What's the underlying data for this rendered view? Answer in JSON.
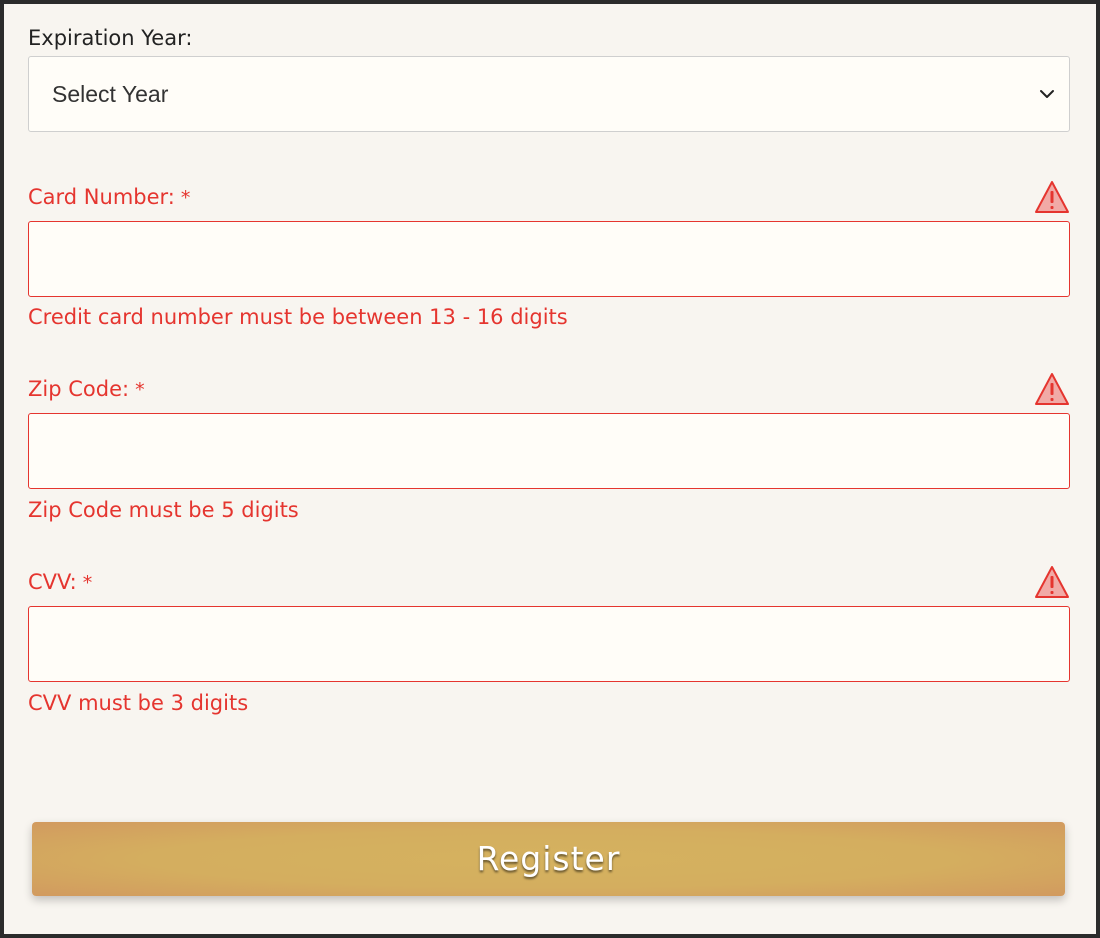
{
  "expiration_year": {
    "label": "Expiration Year:",
    "select_value": "Select Year"
  },
  "card_number": {
    "label": "Card Number:",
    "required_marker": "*",
    "value": "",
    "error": "Credit card number must be between 13 - 16 digits"
  },
  "zip_code": {
    "label": "Zip Code:",
    "required_marker": "*",
    "value": "",
    "error": "Zip Code must be 5 digits"
  },
  "cvv": {
    "label": "CVV:",
    "required_marker": "*",
    "value": "",
    "error": "CVV must be 3 digits"
  },
  "register_button": {
    "label": "Register"
  },
  "colors": {
    "error": "#e5352f",
    "background": "#f8f5f0",
    "button": "#d4ae5f"
  },
  "icons": {
    "select_chevron": "chevron-down-icon",
    "field_warning": "warning-icon"
  }
}
